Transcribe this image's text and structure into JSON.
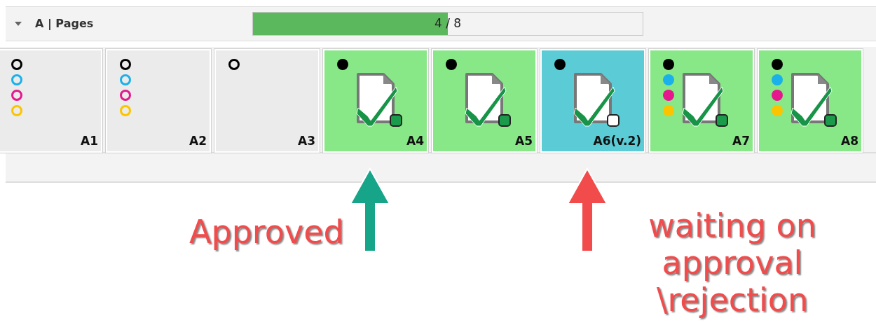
{
  "section": {
    "title": "A | Pages",
    "expanded": true,
    "progress": {
      "text": "4 / 8",
      "level": 0.5
    }
  },
  "pages": [
    {
      "label": "A1",
      "kind": "blank",
      "separations": [
        {
          "color": "#000000",
          "filled": false
        },
        {
          "color": "#1ab0ea",
          "filled": false
        },
        {
          "color": "#e6178c",
          "filled": false
        },
        {
          "color": "#fbc400",
          "filled": false
        }
      ]
    },
    {
      "label": "A2",
      "kind": "blank",
      "separations": [
        {
          "color": "#000000",
          "filled": false
        },
        {
          "color": "#1ab0ea",
          "filled": false
        },
        {
          "color": "#e6178c",
          "filled": false
        },
        {
          "color": "#fbc400",
          "filled": false
        }
      ]
    },
    {
      "label": "A3",
      "kind": "blank",
      "separations": [
        {
          "color": "#000000",
          "filled": false
        }
      ]
    },
    {
      "label": "A4",
      "kind": "approved",
      "separations": [
        {
          "color": "#000000",
          "filled": true
        }
      ],
      "callout": {
        "text": "Approved",
        "color": "#17a589"
      }
    },
    {
      "label": "A5",
      "kind": "approved",
      "separations": [
        {
          "color": "#000000",
          "filled": true
        }
      ]
    },
    {
      "label": "A6(v.2)",
      "kind": "pending",
      "separations": [
        {
          "color": "#000000",
          "filled": true
        }
      ],
      "callout": {
        "text": "waiting on approval \\rejection",
        "color": "#f24b4b"
      }
    },
    {
      "label": "A7",
      "kind": "approved",
      "separations": [
        {
          "color": "#000000",
          "filled": true
        },
        {
          "color": "#1ab0ea",
          "filled": true
        },
        {
          "color": "#e6178c",
          "filled": true
        },
        {
          "color": "#fbc400",
          "filled": true
        }
      ]
    },
    {
      "label": "A8",
      "kind": "approved",
      "separations": [
        {
          "color": "#000000",
          "filled": true
        },
        {
          "color": "#1ab0ea",
          "filled": true
        },
        {
          "color": "#e6178c",
          "filled": true
        },
        {
          "color": "#fbc400",
          "filled": true
        }
      ]
    }
  ]
}
